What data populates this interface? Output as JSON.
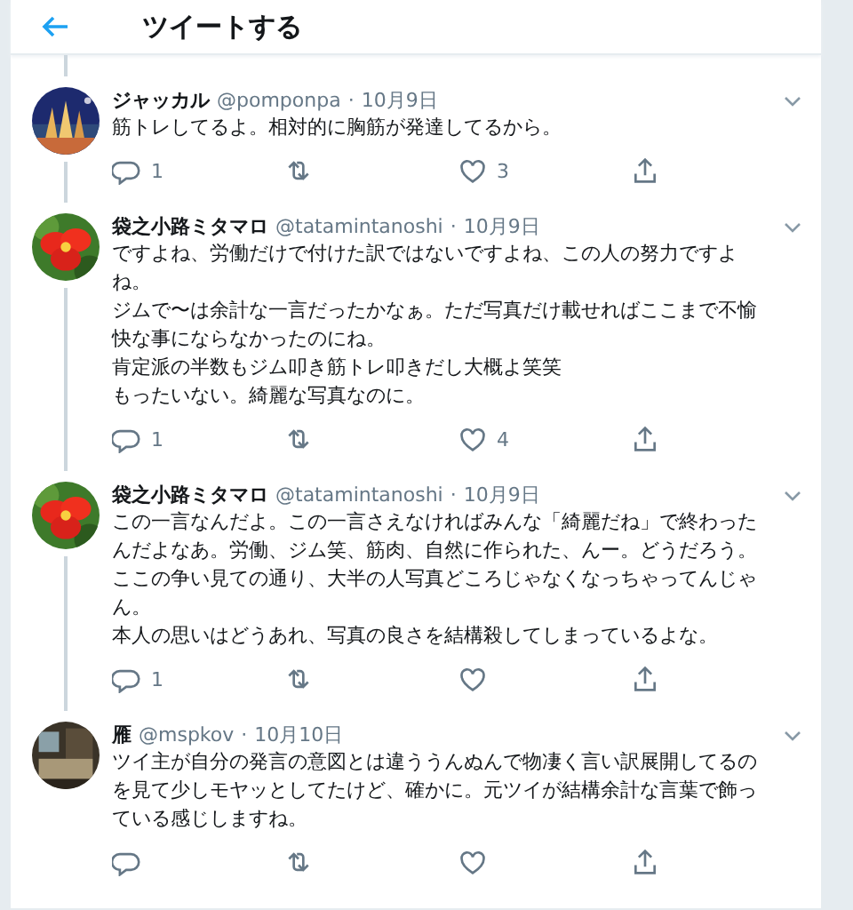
{
  "header": {
    "title": "ツイートする"
  },
  "tweets": [
    {
      "name": "ジャッカル",
      "handle": "@pomponpa",
      "date": "10月9日",
      "lines": [
        "筋トレしてるよ。相対的に胸筋が発達してるから。"
      ],
      "separator": "·",
      "replies": "1",
      "likes": "3"
    },
    {
      "name": "袋之小路ミタマロ",
      "handle": "@tatamintanoshi",
      "date": "10月9日",
      "lines": [
        "ですよね、労働だけで付けた訳ではないですよね、この人の努力ですよね。",
        "ジムで〜は余計な一言だったかなぁ。ただ写真だけ載せればここまで不愉快な事にならなかったのにね。",
        "肯定派の半数もジム叩き筋トレ叩きだし大概よ笑笑",
        "もったいない。綺麗な写真なのに。"
      ],
      "separator": "·",
      "replies": "1",
      "likes": "4"
    },
    {
      "name": "袋之小路ミタマロ",
      "handle": "@tatamintanoshi",
      "date": "10月9日",
      "lines": [
        "この一言なんだよ。この一言さえなければみんな「綺麗だね」で終わったんだよなあ。労働、ジム笑、筋肉、自然に作られた、んー。どうだろう。",
        "ここの争い見ての通り、大半の人写真どころじゃなくなっちゃってんじゃん。",
        "本人の思いはどうあれ、写真の良さを結構殺してしまっているよな。"
      ],
      "separator": "·",
      "replies": "1"
    },
    {
      "name": "雁",
      "handle": "@mspkov",
      "date": "10月10日",
      "lines": [
        "ツイ主が自分の発言の意図とは違ううんぬんで物凄く言い訳展開してるのを見て少しモヤッとしてたけど、確かに。元ツイが結構余計な言葉で飾っている感じしますね。"
      ],
      "separator": "·"
    }
  ]
}
